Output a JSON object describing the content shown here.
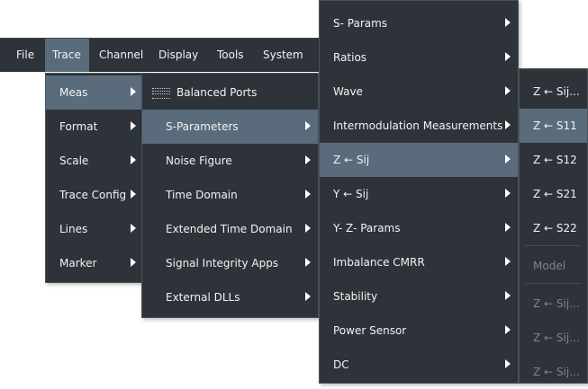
{
  "menubar": {
    "items": [
      {
        "label": "File"
      },
      {
        "label": "Trace",
        "active": true
      },
      {
        "label": "Channel"
      },
      {
        "label": "Display"
      },
      {
        "label": "Tools"
      },
      {
        "label": "System"
      }
    ]
  },
  "trace_menu": {
    "items": [
      {
        "label": "Meas",
        "highlighted": true,
        "submenu": true
      },
      {
        "label": "Format",
        "submenu": true
      },
      {
        "label": "Scale",
        "submenu": true
      },
      {
        "label": "Trace Config",
        "submenu": true
      },
      {
        "label": "Lines",
        "submenu": true
      },
      {
        "label": "Marker",
        "submenu": true
      }
    ]
  },
  "meas_menu": {
    "items": [
      {
        "label": "Balanced Ports",
        "icon": "balanced-ports-icon"
      },
      {
        "label": "S-Parameters",
        "highlighted": true,
        "submenu": true
      },
      {
        "label": "Noise Figure",
        "submenu": true
      },
      {
        "label": "Time Domain",
        "submenu": true
      },
      {
        "label": "Extended Time Domain",
        "submenu": true
      },
      {
        "label": "Signal Integrity Apps",
        "submenu": true
      },
      {
        "label": "External DLLs",
        "submenu": true
      }
    ]
  },
  "sparams_menu": {
    "items": [
      {
        "label": "S- Params",
        "submenu": true
      },
      {
        "label": "Ratios",
        "submenu": true
      },
      {
        "label": "Wave",
        "submenu": true
      },
      {
        "label": "Intermodulation Measurements",
        "submenu": true
      },
      {
        "label": "Z ← Sij",
        "highlighted": true,
        "submenu": true
      },
      {
        "label": "Y ← Sij",
        "submenu": true
      },
      {
        "label": "Y- Z-  Params",
        "submenu": true
      },
      {
        "label": "Imbalance CMRR",
        "submenu": true
      },
      {
        "label": "Stability",
        "submenu": true
      },
      {
        "label": "Power Sensor",
        "submenu": true
      },
      {
        "label": "DC",
        "submenu": true
      }
    ]
  },
  "z_menu": {
    "items": [
      {
        "label": "Z ← Sij..."
      },
      {
        "label": "Z ← S11",
        "highlighted": true
      },
      {
        "label": "Z ← S12"
      },
      {
        "label": "Z ← S21"
      },
      {
        "label": "Z ← S22"
      },
      {
        "label": "Model",
        "disabled": true
      },
      {
        "label": "Z ← Sij...",
        "disabled": true
      },
      {
        "label": "Z ← Sij...",
        "disabled": true
      },
      {
        "label": "Z ← Sij...",
        "disabled": true
      }
    ]
  }
}
